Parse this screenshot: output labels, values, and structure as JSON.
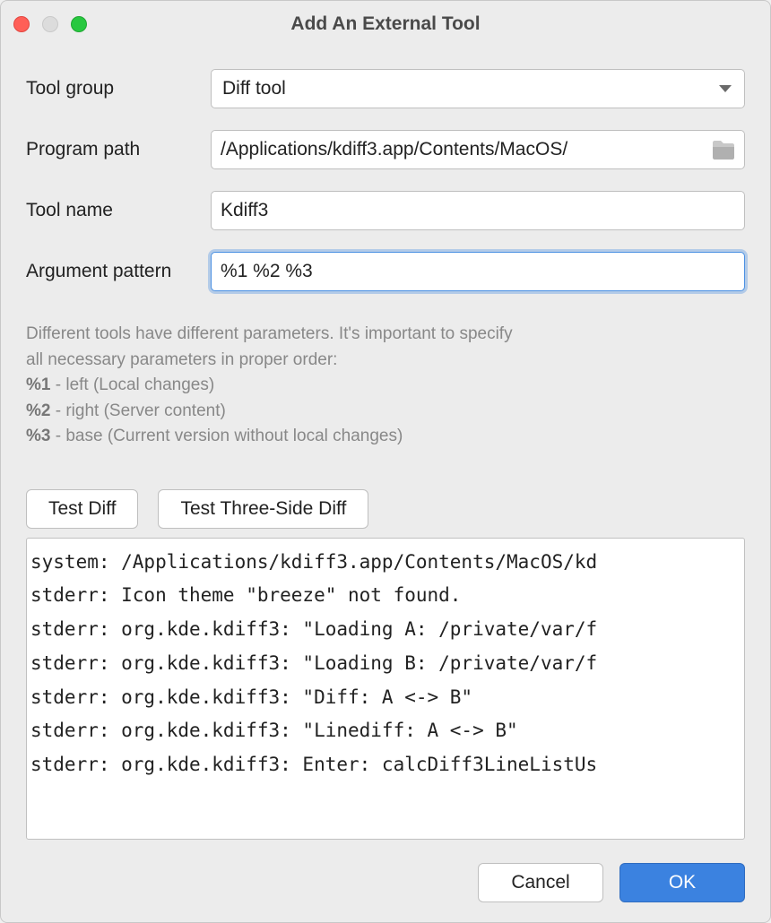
{
  "title": "Add An External Tool",
  "form": {
    "tool_group_label": "Tool group",
    "tool_group_value": "Diff tool",
    "program_path_label": "Program path",
    "program_path_value": "/Applications/kdiff3.app/Contents/MacOS/",
    "tool_name_label": "Tool name",
    "tool_name_value": "Kdiff3",
    "argument_pattern_label": "Argument pattern",
    "argument_pattern_value": "%1 %2 %3"
  },
  "help": {
    "intro_line1": "Different tools have different parameters. It's important to specify",
    "intro_line2": "all necessary parameters in proper order:",
    "p1_key": "%1",
    "p1_desc": " - left (Local changes)",
    "p2_key": "%2",
    "p2_desc": " - right (Server content)",
    "p3_key": "%3",
    "p3_desc": " - base (Current version without local changes)"
  },
  "buttons": {
    "test_diff": "Test Diff",
    "test_three_side": "Test Three-Side Diff",
    "cancel": "Cancel",
    "ok": "OK"
  },
  "output": "system: /Applications/kdiff3.app/Contents/MacOS/kd\nstderr: Icon theme \"breeze\" not found.\nstderr: org.kde.kdiff3: \"Loading A: /private/var/f\nstderr: org.kde.kdiff3: \"Loading B: /private/var/f\nstderr: org.kde.kdiff3: \"Diff: A <-> B\"\nstderr: org.kde.kdiff3: \"Linediff: A <-> B\"\nstderr: org.kde.kdiff3: Enter: calcDiff3LineListUs"
}
